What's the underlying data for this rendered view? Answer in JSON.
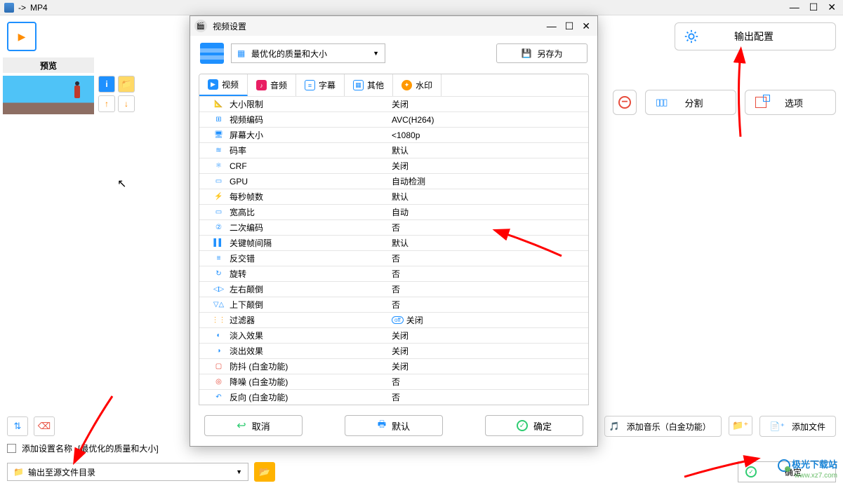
{
  "titlebar": {
    "arrow": "->",
    "format": "MP4"
  },
  "toolbar": {
    "output_config": "输出配置"
  },
  "preview": {
    "header": "预览"
  },
  "ops": {
    "remove_visible_partial": "",
    "split": "分割",
    "options": "选项"
  },
  "dialog": {
    "title": "视频设置",
    "preset": "最优化的质量和大小",
    "save_as": "另存为",
    "tabs": {
      "video": "视频",
      "audio": "音频",
      "subtitle": "字幕",
      "other": "其他",
      "watermark": "水印"
    },
    "rows": [
      {
        "k": "大小限制",
        "v": "关闭",
        "ic": "📐",
        "c": "#1e90ff"
      },
      {
        "k": "视频编码",
        "v": "AVC(H264)",
        "ic": "⊞",
        "c": "#1e90ff"
      },
      {
        "k": "屏幕大小",
        "v": "<1080p",
        "ic": "🖥",
        "c": "#1e90ff"
      },
      {
        "k": "码率",
        "v": "默认",
        "ic": "≋",
        "c": "#1e90ff"
      },
      {
        "k": "CRF",
        "v": "关闭",
        "ic": "⚛",
        "c": "#1e90ff"
      },
      {
        "k": "GPU",
        "v": "自动检测",
        "ic": "▭",
        "c": "#1e90ff"
      },
      {
        "k": "每秒帧数",
        "v": "默认",
        "ic": "⚡",
        "c": "#ff9800"
      },
      {
        "k": "宽高比",
        "v": "自动",
        "ic": "▭",
        "c": "#1e90ff"
      },
      {
        "k": "二次编码",
        "v": "否",
        "ic": "②",
        "c": "#1e90ff"
      },
      {
        "k": "关键帧间隔",
        "v": "默认",
        "ic": "▌▌",
        "c": "#1e90ff"
      },
      {
        "k": "反交错",
        "v": "否",
        "ic": "≡",
        "c": "#1e90ff"
      },
      {
        "k": "旋转",
        "v": "否",
        "ic": "↻",
        "c": "#1e90ff"
      },
      {
        "k": "左右颠倒",
        "v": "否",
        "ic": "◁▷",
        "c": "#1e90ff"
      },
      {
        "k": "上下颠倒",
        "v": "否",
        "ic": "▽△",
        "c": "#1e90ff"
      },
      {
        "k": "过滤器",
        "v": "关闭",
        "ic": "⋮⋮",
        "c": "#ff9800",
        "off": true
      },
      {
        "k": "淡入效果",
        "v": "关闭",
        "ic": "◐",
        "c": "#1e90ff"
      },
      {
        "k": "淡出效果",
        "v": "关闭",
        "ic": "◑",
        "c": "#1e90ff"
      },
      {
        "k": "防抖 (白金功能)",
        "v": "关闭",
        "ic": "▢",
        "c": "#e74c3c"
      },
      {
        "k": "降噪 (白金功能)",
        "v": "否",
        "ic": "◎",
        "c": "#e74c3c"
      },
      {
        "k": "反向 (白金功能)",
        "v": "否",
        "ic": "↶",
        "c": "#1e90ff"
      }
    ],
    "cancel": "取消",
    "default": "默认",
    "ok": "确定"
  },
  "bottom": {
    "add_music": "添加音乐（白金功能）",
    "add_file": "添加文件",
    "add_settings_label": "添加设置名称",
    "settings_hint": "[最优化的质量和大小]",
    "output_dir": "输出至源文件目录",
    "confirm": "确定"
  },
  "watermark": {
    "l1": "极光下载站",
    "l2": "www.xz7.com"
  }
}
